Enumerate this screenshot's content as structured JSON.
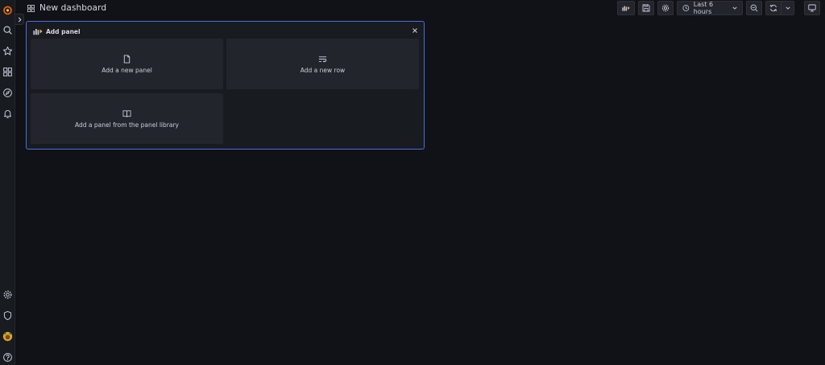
{
  "header": {
    "title": "New dashboard",
    "time_range_label": "Last 6 hours"
  },
  "sidebar": {
    "top_items": [
      "grafana-logo",
      "search-icon",
      "starred-icon",
      "dashboards-icon",
      "explore-icon",
      "alerting-icon"
    ],
    "bottom_items": [
      "configuration-icon",
      "server-admin-icon",
      "user-avatar",
      "help-icon"
    ]
  },
  "add_panel": {
    "title": "Add panel",
    "options": {
      "new_panel": "Add a new panel",
      "new_row": "Add a new row",
      "from_library": "Add a panel from the panel library"
    }
  },
  "colors": {
    "background": "#111217",
    "panel": "#181b1f",
    "card": "#22252b",
    "accent_border": "#4a6fd8",
    "logo_orange": "#f46800"
  }
}
